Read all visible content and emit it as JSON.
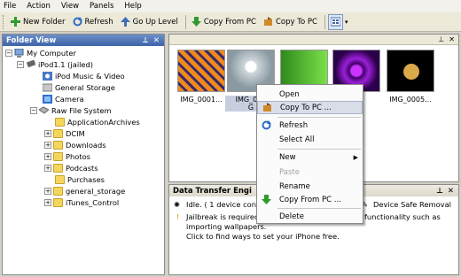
{
  "menubar": {
    "items": [
      "File",
      "Action",
      "View",
      "Panels",
      "Help"
    ]
  },
  "toolbar": {
    "new_folder": "New Folder",
    "refresh": "Refresh",
    "go_up": "Go Up Level",
    "copy_from_pc": "Copy From PC",
    "copy_to_pc": "Copy To PC"
  },
  "folder_view": {
    "title": "Folder View",
    "tree": {
      "my_computer": "My Computer",
      "ipod": "iPod1.1 (jailed)",
      "music_video": "iPod Music & Video",
      "general_storage": "General Storage",
      "camera": "Camera",
      "raw_fs": "Raw File System",
      "folders": [
        "ApplicationArchives",
        "DCIM",
        "Downloads",
        "Photos",
        "Podcasts",
        "Purchases",
        "general_storage",
        "iTunes_Control"
      ]
    }
  },
  "files": {
    "thumbnails": [
      {
        "label": "IMG_0001...",
        "color": "#e08a1e"
      },
      {
        "label": "IMG_000",
        "label2": "G",
        "color": "#b9c6cc"
      },
      {
        "label": "",
        "color": "#3fb02c"
      },
      {
        "label": "",
        "color": "#6b0f9a"
      },
      {
        "label": "IMG_0005...",
        "color": "#000000"
      }
    ]
  },
  "transfer": {
    "title": "Data Transfer Engi",
    "status": "Idle. ( 1 device conn",
    "safe_removal": "Device Safe Removal",
    "jailbreak_1": "Jailbreak is required",
    "jailbreak_1b": "functionality such as",
    "jailbreak_2": "importing wallpapers.",
    "jailbreak_3": "Click to find ways to set your iPhone free."
  },
  "context_menu": {
    "items": [
      "Open",
      "Copy To PC ...",
      "Refresh",
      "Select All",
      "New",
      "Paste",
      "Rename",
      "Copy From PC ...",
      "Delete"
    ]
  }
}
